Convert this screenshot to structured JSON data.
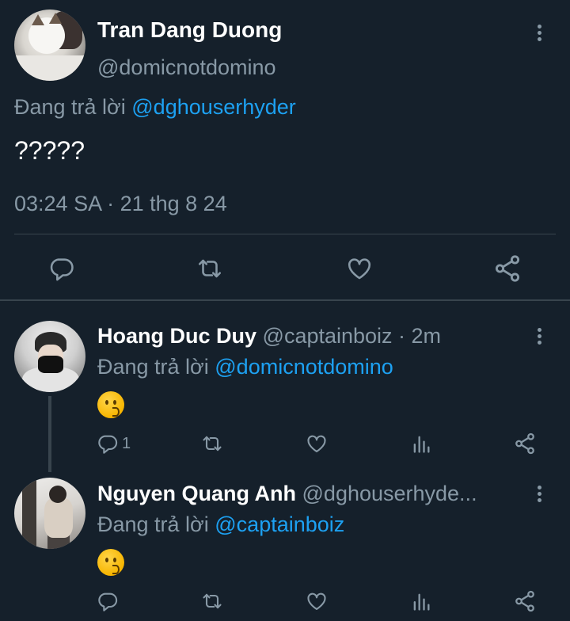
{
  "main_tweet": {
    "author_name": "Tran Dang Duong",
    "author_handle": "@domicnotdomino",
    "replying_prefix": "Đang trả lời ",
    "replying_to": "@dghouserhyder",
    "text": "?????",
    "timestamp": "03:24 SA · 21 thg 8 24",
    "actions": [
      "reply-icon",
      "retweet-icon",
      "like-icon",
      "share-icon"
    ]
  },
  "replies": [
    {
      "author_name": "Hoang Duc Duy",
      "author_handle": "@captainboiz",
      "time": " · 2m",
      "replying_prefix": "Đang trả lời ",
      "replying_to": "@domicnotdomino",
      "emoji": "kissing-face-emoji",
      "reply_count": "1",
      "actions": [
        "reply-icon",
        "retweet-icon",
        "like-icon",
        "analytics-icon",
        "share-icon"
      ]
    },
    {
      "author_name": "Nguyen Quang Anh",
      "author_handle": "@dghouserhyde...",
      "replying_prefix": "Đang trả lời ",
      "replying_to": "@captainboiz",
      "emoji": "kissing-face-emoji",
      "actions": [
        "reply-icon",
        "retweet-icon",
        "like-icon",
        "analytics-icon",
        "share-icon"
      ]
    }
  ],
  "colors": {
    "background": "#15202b",
    "text_primary": "#ffffff",
    "text_secondary": "#8899a6",
    "link": "#1da1f2",
    "divider": "#38444d"
  }
}
